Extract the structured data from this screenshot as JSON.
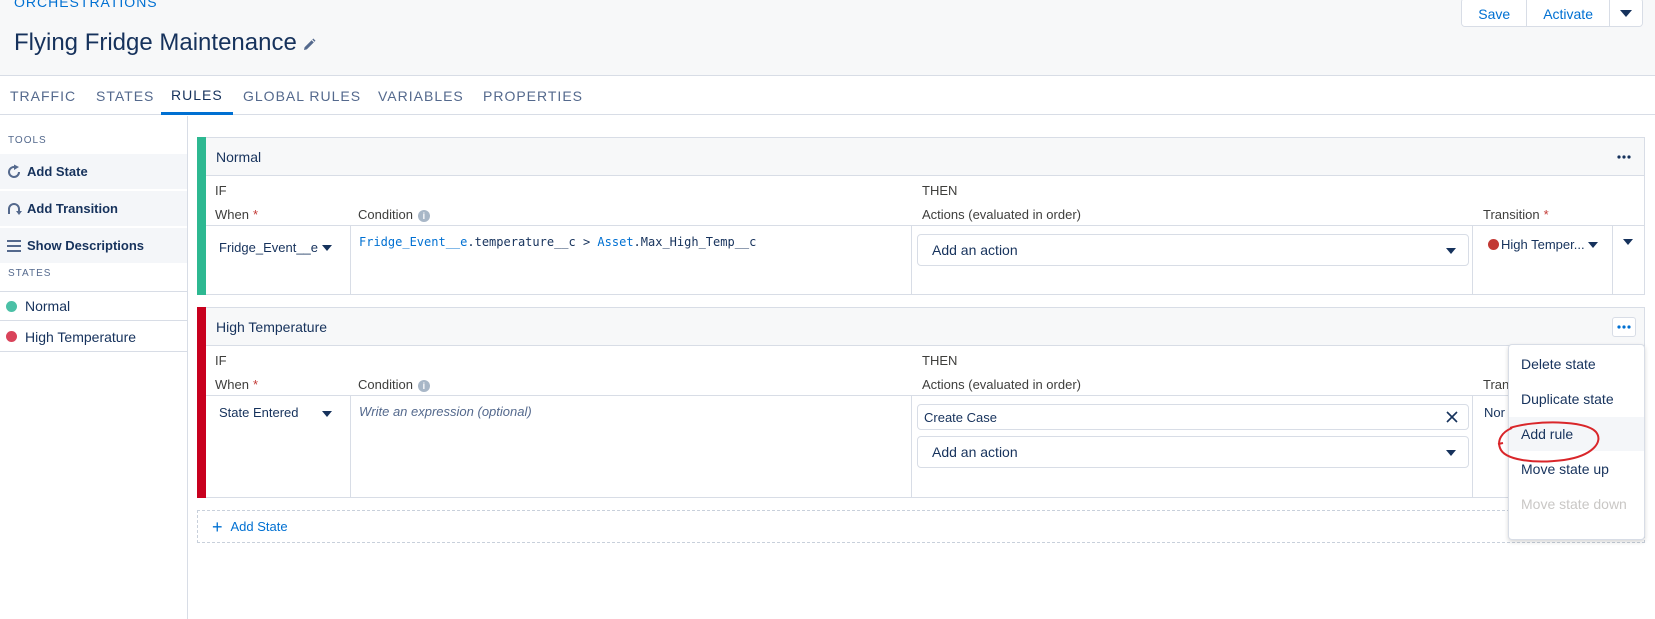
{
  "header": {
    "breadcrumb": "ORCHESTRATIONS",
    "title": "Flying Fridge Maintenance",
    "buttons": {
      "save": "Save",
      "activate": "Activate"
    }
  },
  "tabs": [
    "TRAFFIC",
    "STATES",
    "RULES",
    "GLOBAL RULES",
    "VARIABLES",
    "PROPERTIES"
  ],
  "active_tab": "RULES",
  "sidebar": {
    "tools_heading": "TOOLS",
    "tools": [
      "Add State",
      "Add Transition",
      "Show Descriptions"
    ],
    "states_heading": "STATES",
    "states": [
      {
        "name": "Normal",
        "color": "#4bc0a6"
      },
      {
        "name": "High Temperature",
        "color": "#d9435a"
      }
    ]
  },
  "labels": {
    "if": "IF",
    "then": "THEN",
    "when": "When",
    "required": "*",
    "condition": "Condition",
    "actions": "Actions (evaluated in order)",
    "transition": "Transition",
    "transition_truncated": "Trans",
    "add_action": "Add an action"
  },
  "states": [
    {
      "name": "Normal",
      "stripe_color": "#2db891",
      "when": "Fridge_Event__e",
      "condition": {
        "obj1": "Fridge_Event__e",
        "rest1": ".temperature__c > ",
        "obj2": "Asset",
        "rest2": ".Max_High_Temp__c"
      },
      "transition": {
        "label": "High Temper...",
        "dot_color": "#c23934"
      }
    },
    {
      "name": "High Temperature",
      "stripe_color": "#c8001e",
      "when": "State Entered",
      "condition_placeholder": "Write an expression (optional)",
      "action": "Create Case",
      "transition_text": "Nor"
    }
  ],
  "add_state_label": "Add State",
  "context_menu": {
    "items": [
      "Delete state",
      "Duplicate state",
      "Add rule",
      "Move state up",
      "Move state down"
    ],
    "hovered": "Add rule",
    "disabled": "Move state down"
  },
  "colors": {
    "accent": "#0070d2",
    "text": "#16325c",
    "annotation": "#d9262a"
  }
}
